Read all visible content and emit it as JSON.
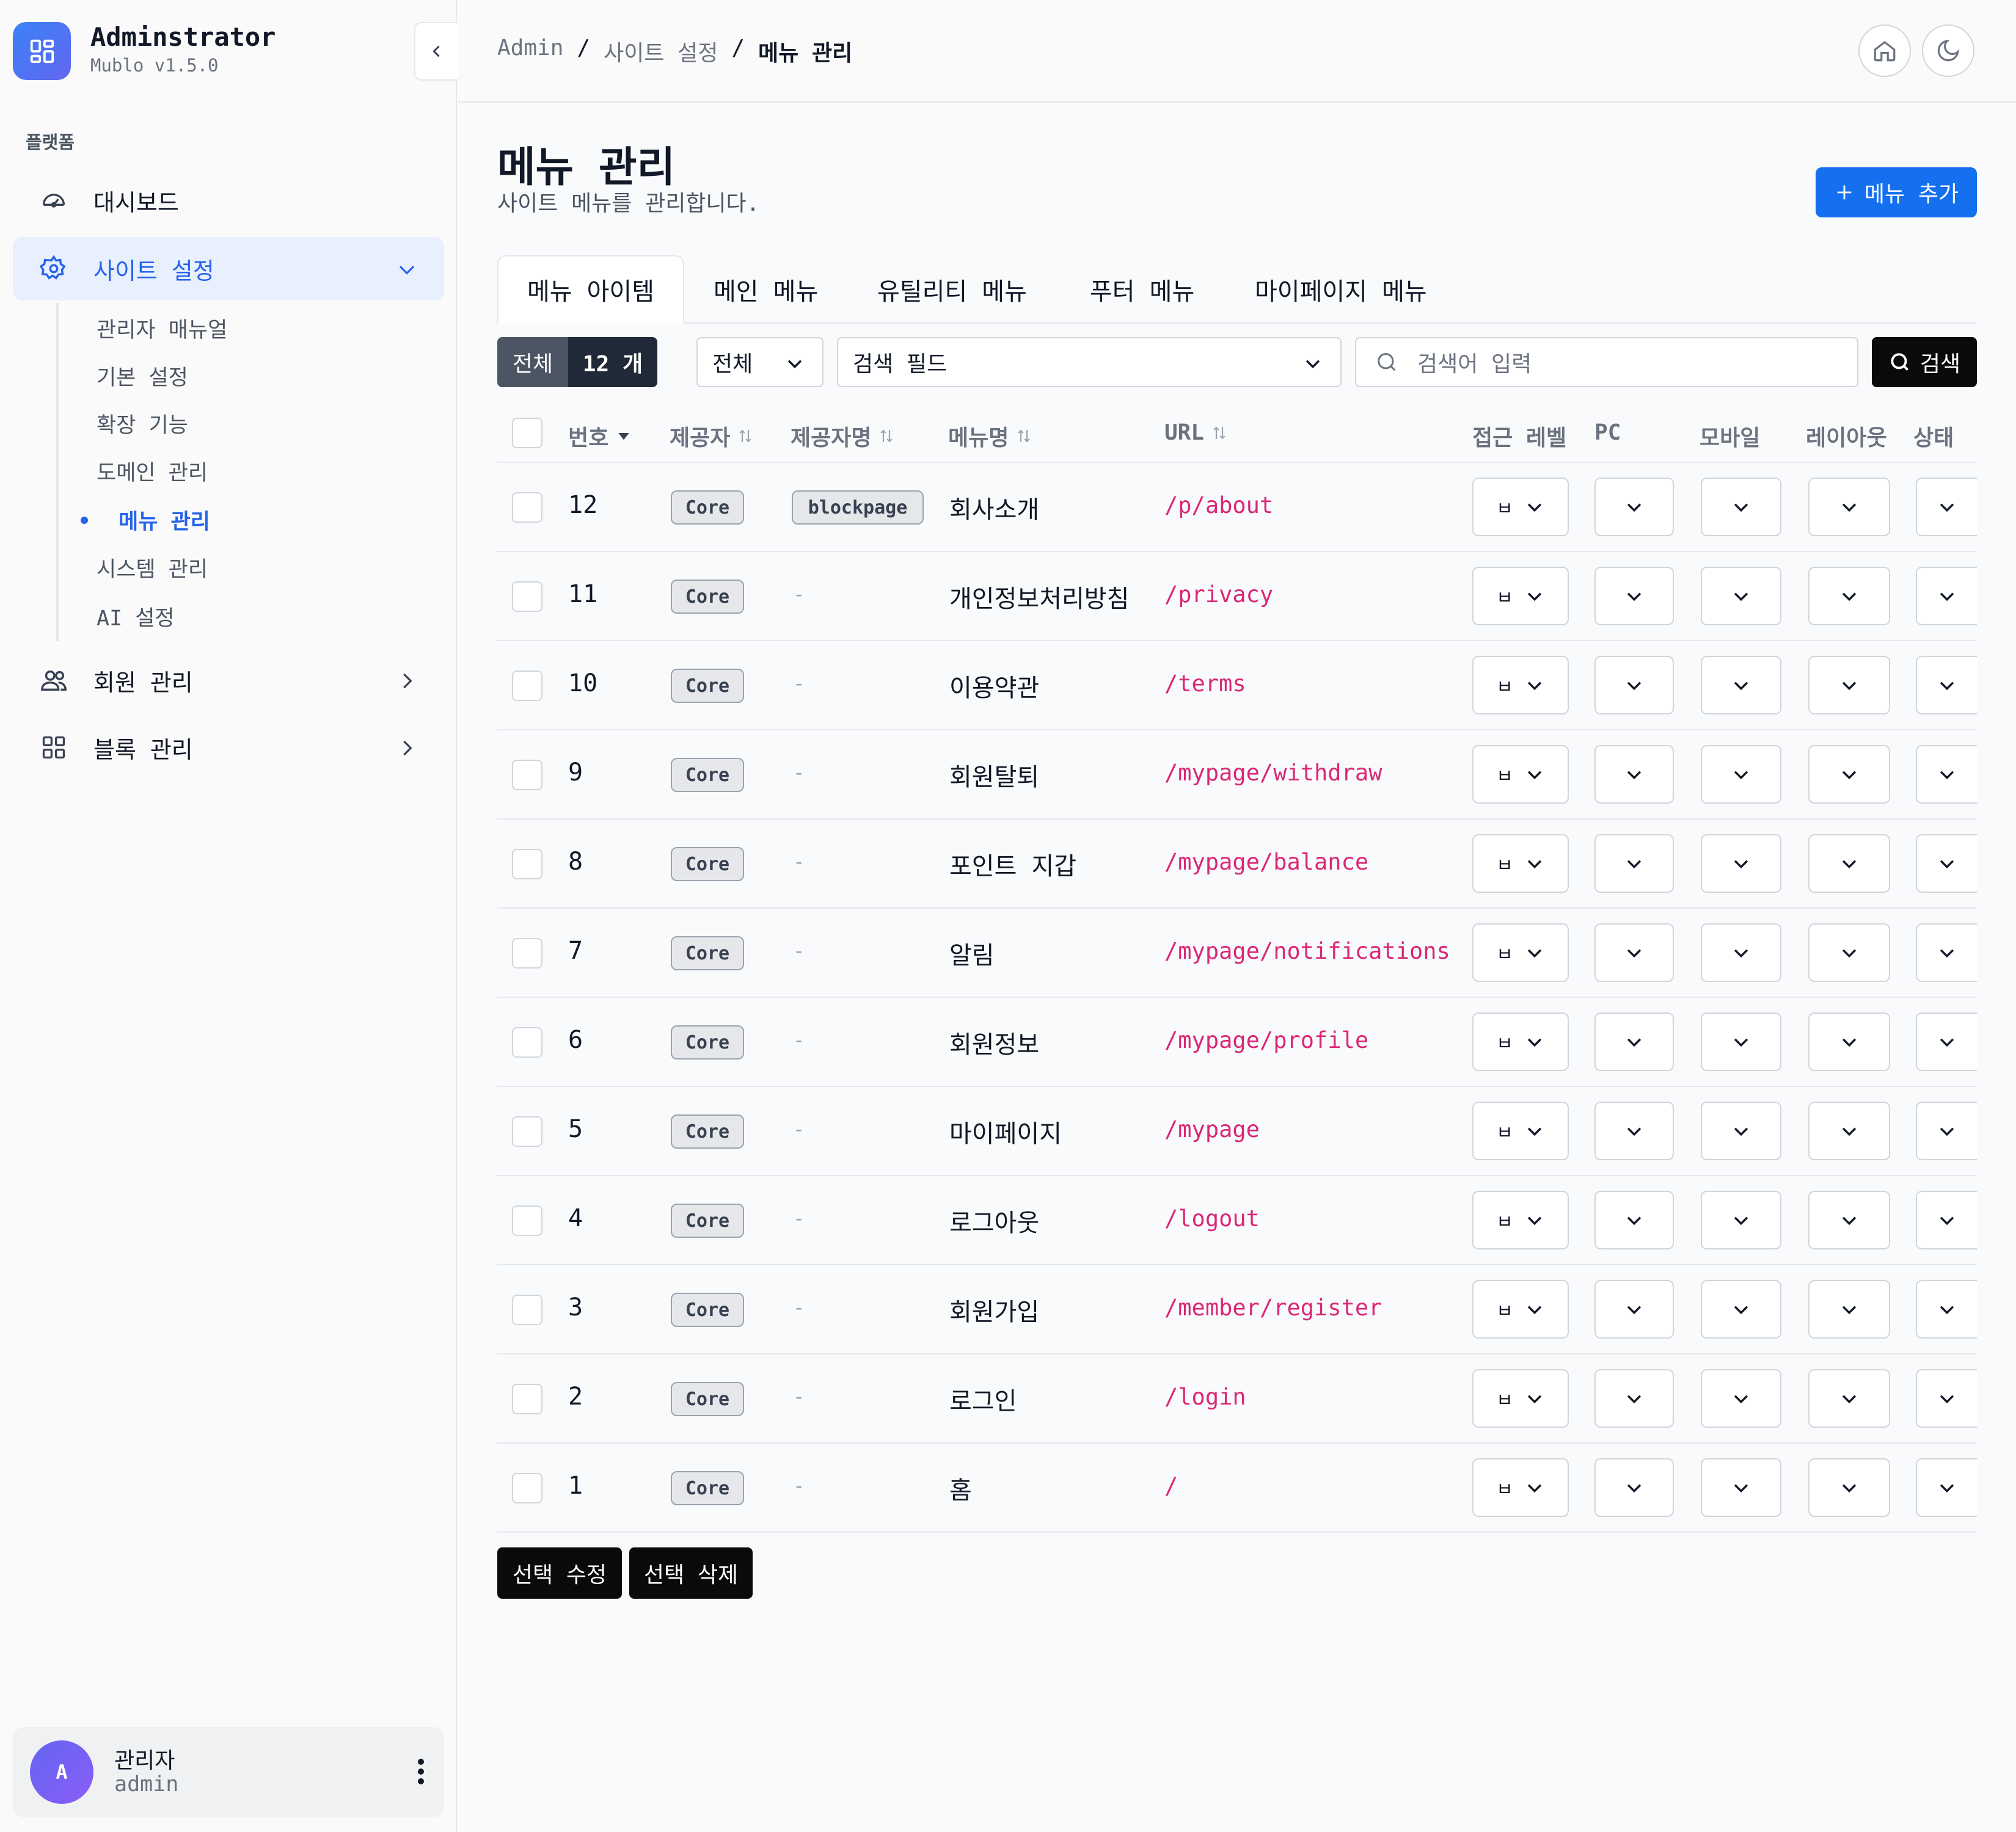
{
  "app": {
    "title": "Adminstrator",
    "version": "Mublo v1.5.0"
  },
  "sidebar": {
    "section": "플랫폼",
    "items": [
      {
        "label": "대시보드",
        "icon": "dashboard-gauge-icon"
      },
      {
        "label": "사이트 설정",
        "icon": "gear-icon",
        "expanded": true
      },
      {
        "label": "회원 관리",
        "icon": "users-icon"
      },
      {
        "label": "블록 관리",
        "icon": "grid-icon"
      }
    ],
    "subitems": [
      "관리자 매뉴얼",
      "기본 설정",
      "확장 기능",
      "도메인 관리",
      "메뉴 관리",
      "시스템 관리",
      "AI 설정"
    ],
    "active_sub": "메뉴 관리",
    "user": {
      "initial": "A",
      "name": "관리자",
      "id": "admin"
    }
  },
  "breadcrumb": [
    "Admin",
    "사이트 설정",
    "메뉴 관리"
  ],
  "breadcrumb_sep": "/",
  "page": {
    "title": "메뉴 관리",
    "subtitle": "사이트 메뉴를 관리합니다.",
    "add_button": "메뉴 추가"
  },
  "tabs": [
    "메뉴 아이템",
    "메인 메뉴",
    "유틸리티 메뉴",
    "푸터 메뉴",
    "마이페이지 메뉴"
  ],
  "filter": {
    "all_label": "전체",
    "count": "12 개",
    "type_select": "전체",
    "field_select": "검색 필드",
    "search_placeholder": "검색어 입력",
    "search_button": "검색"
  },
  "table": {
    "columns": [
      "번호",
      "제공자",
      "제공자명",
      "메뉴명",
      "URL",
      "접근 레벨",
      "PC",
      "모바일",
      "레이아웃",
      "상태"
    ],
    "rows": [
      {
        "no": "12",
        "provider": "Core",
        "provider_name": "blockpage",
        "menu": "회사소개",
        "url": "/p/about",
        "level": "ㅂ"
      },
      {
        "no": "11",
        "provider": "Core",
        "provider_name": "-",
        "menu": "개인정보처리방침",
        "url": "/privacy",
        "level": "ㅂ"
      },
      {
        "no": "10",
        "provider": "Core",
        "provider_name": "-",
        "menu": "이용약관",
        "url": "/terms",
        "level": "ㅂ"
      },
      {
        "no": "9",
        "provider": "Core",
        "provider_name": "-",
        "menu": "회원탈퇴",
        "url": "/mypage/withdraw",
        "level": "ㅂ"
      },
      {
        "no": "8",
        "provider": "Core",
        "provider_name": "-",
        "menu": "포인트 지갑",
        "url": "/mypage/balance",
        "level": "ㅂ"
      },
      {
        "no": "7",
        "provider": "Core",
        "provider_name": "-",
        "menu": "알림",
        "url": "/mypage/notifications",
        "level": "ㅂ"
      },
      {
        "no": "6",
        "provider": "Core",
        "provider_name": "-",
        "menu": "회원정보",
        "url": "/mypage/profile",
        "level": "ㅂ"
      },
      {
        "no": "5",
        "provider": "Core",
        "provider_name": "-",
        "menu": "마이페이지",
        "url": "/mypage",
        "level": "ㅂ"
      },
      {
        "no": "4",
        "provider": "Core",
        "provider_name": "-",
        "menu": "로그아웃",
        "url": "/logout",
        "level": "ㅂ"
      },
      {
        "no": "3",
        "provider": "Core",
        "provider_name": "-",
        "menu": "회원가입",
        "url": "/member/register",
        "level": "ㅂ"
      },
      {
        "no": "2",
        "provider": "Core",
        "provider_name": "-",
        "menu": "로그인",
        "url": "/login",
        "level": "ㅂ"
      },
      {
        "no": "1",
        "provider": "Core",
        "provider_name": "-",
        "menu": "홈",
        "url": "/",
        "level": "ㅂ"
      }
    ]
  },
  "actions": {
    "edit": "선택 수정",
    "delete": "선택 삭제"
  },
  "colors": {
    "accent": "#1570ef",
    "url": "#db2777",
    "active_nav_bg": "#e8effd"
  }
}
